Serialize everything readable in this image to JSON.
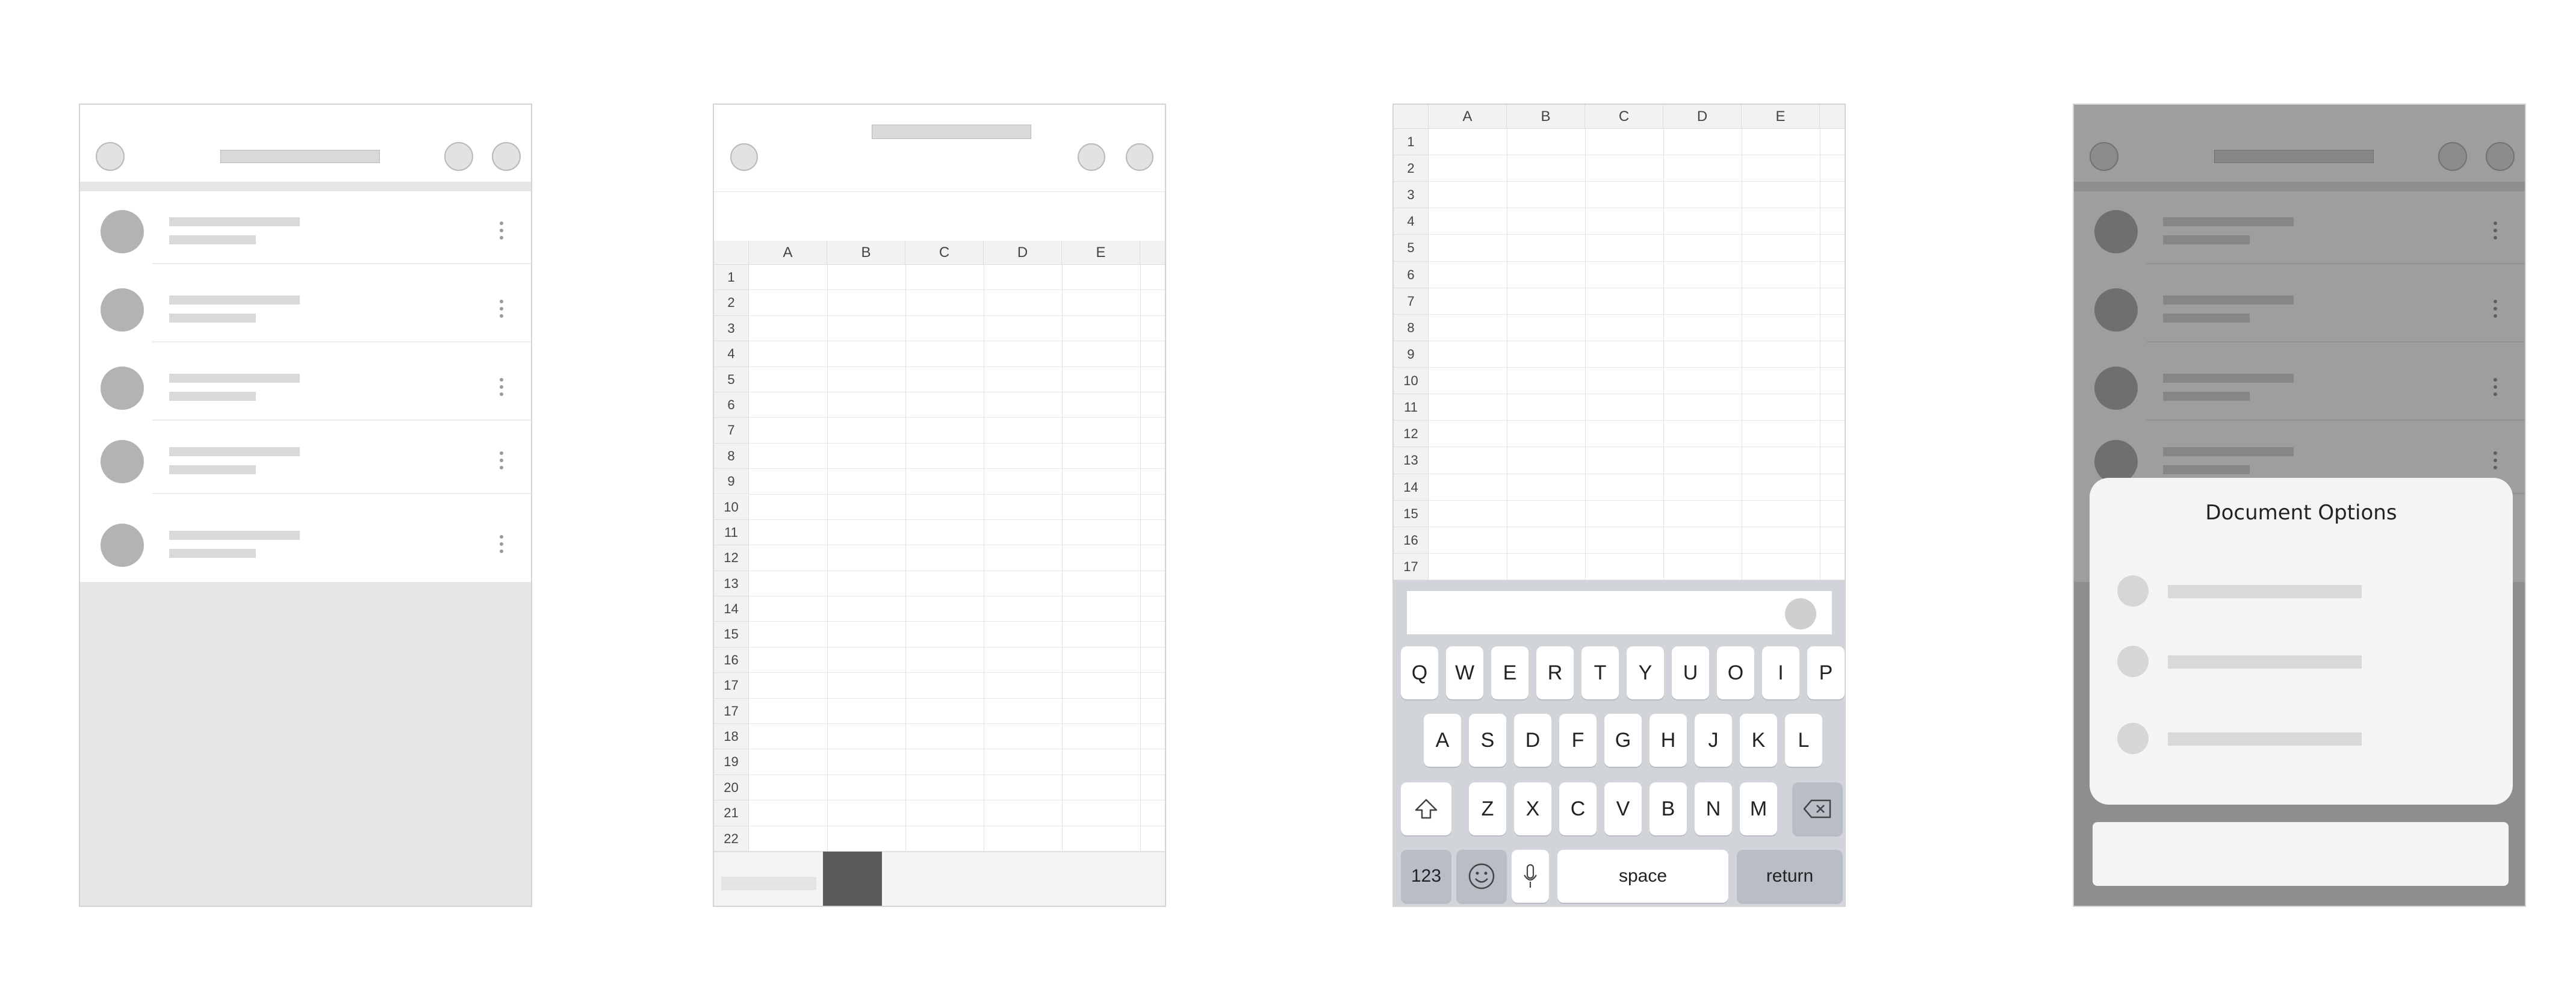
{
  "screen1": {
    "row_count": 5
  },
  "screen2": {
    "columns": [
      "A",
      "B",
      "C",
      "D",
      "E"
    ],
    "rows": [
      "1",
      "2",
      "3",
      "4",
      "5",
      "6",
      "7",
      "8",
      "9",
      "10",
      "11",
      "12",
      "13",
      "14",
      "15",
      "16",
      "17",
      "17",
      "18",
      "19",
      "20",
      "21",
      "22"
    ]
  },
  "screen3": {
    "columns": [
      "A",
      "B",
      "C",
      "D",
      "E"
    ],
    "rows": [
      "1",
      "2",
      "3",
      "4",
      "5",
      "6",
      "7",
      "8",
      "9",
      "10",
      "11",
      "12",
      "13",
      "14",
      "15",
      "16",
      "17"
    ],
    "keyboard": {
      "row1": [
        "Q",
        "W",
        "E",
        "R",
        "T",
        "Y",
        "U",
        "O",
        "I",
        "P"
      ],
      "row2": [
        "A",
        "S",
        "D",
        "F",
        "G",
        "H",
        "J",
        "K",
        "L"
      ],
      "row3": [
        "Z",
        "X",
        "C",
        "V",
        "B",
        "N",
        "M"
      ],
      "numbers_key": "123",
      "space_key": "space",
      "return_key": "return"
    }
  },
  "screen4": {
    "modal_title": "Document Options"
  },
  "colors": {
    "placeholder": "#d9d9d9",
    "avatar": "#b3b3b3",
    "keyboard_bg": "#d1d4d9",
    "overlay": "rgba(0,0,0,0.38)"
  },
  "icons": [
    "shift-icon",
    "backspace-icon",
    "emoji-icon",
    "microphone-icon",
    "kebab-menu-icon"
  ]
}
